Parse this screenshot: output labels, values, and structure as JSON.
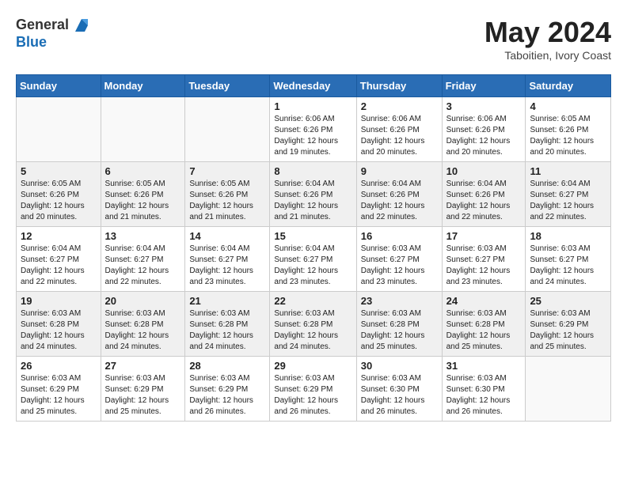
{
  "header": {
    "logo_general": "General",
    "logo_blue": "Blue",
    "month_year": "May 2024",
    "location": "Taboitien, Ivory Coast"
  },
  "weekdays": [
    "Sunday",
    "Monday",
    "Tuesday",
    "Wednesday",
    "Thursday",
    "Friday",
    "Saturday"
  ],
  "weeks": [
    [
      {
        "day": "",
        "info": ""
      },
      {
        "day": "",
        "info": ""
      },
      {
        "day": "",
        "info": ""
      },
      {
        "day": "1",
        "info": "Sunrise: 6:06 AM\nSunset: 6:26 PM\nDaylight: 12 hours\nand 19 minutes."
      },
      {
        "day": "2",
        "info": "Sunrise: 6:06 AM\nSunset: 6:26 PM\nDaylight: 12 hours\nand 20 minutes."
      },
      {
        "day": "3",
        "info": "Sunrise: 6:06 AM\nSunset: 6:26 PM\nDaylight: 12 hours\nand 20 minutes."
      },
      {
        "day": "4",
        "info": "Sunrise: 6:05 AM\nSunset: 6:26 PM\nDaylight: 12 hours\nand 20 minutes."
      }
    ],
    [
      {
        "day": "5",
        "info": "Sunrise: 6:05 AM\nSunset: 6:26 PM\nDaylight: 12 hours\nand 20 minutes."
      },
      {
        "day": "6",
        "info": "Sunrise: 6:05 AM\nSunset: 6:26 PM\nDaylight: 12 hours\nand 21 minutes."
      },
      {
        "day": "7",
        "info": "Sunrise: 6:05 AM\nSunset: 6:26 PM\nDaylight: 12 hours\nand 21 minutes."
      },
      {
        "day": "8",
        "info": "Sunrise: 6:04 AM\nSunset: 6:26 PM\nDaylight: 12 hours\nand 21 minutes."
      },
      {
        "day": "9",
        "info": "Sunrise: 6:04 AM\nSunset: 6:26 PM\nDaylight: 12 hours\nand 22 minutes."
      },
      {
        "day": "10",
        "info": "Sunrise: 6:04 AM\nSunset: 6:26 PM\nDaylight: 12 hours\nand 22 minutes."
      },
      {
        "day": "11",
        "info": "Sunrise: 6:04 AM\nSunset: 6:27 PM\nDaylight: 12 hours\nand 22 minutes."
      }
    ],
    [
      {
        "day": "12",
        "info": "Sunrise: 6:04 AM\nSunset: 6:27 PM\nDaylight: 12 hours\nand 22 minutes."
      },
      {
        "day": "13",
        "info": "Sunrise: 6:04 AM\nSunset: 6:27 PM\nDaylight: 12 hours\nand 22 minutes."
      },
      {
        "day": "14",
        "info": "Sunrise: 6:04 AM\nSunset: 6:27 PM\nDaylight: 12 hours\nand 23 minutes."
      },
      {
        "day": "15",
        "info": "Sunrise: 6:04 AM\nSunset: 6:27 PM\nDaylight: 12 hours\nand 23 minutes."
      },
      {
        "day": "16",
        "info": "Sunrise: 6:03 AM\nSunset: 6:27 PM\nDaylight: 12 hours\nand 23 minutes."
      },
      {
        "day": "17",
        "info": "Sunrise: 6:03 AM\nSunset: 6:27 PM\nDaylight: 12 hours\nand 23 minutes."
      },
      {
        "day": "18",
        "info": "Sunrise: 6:03 AM\nSunset: 6:27 PM\nDaylight: 12 hours\nand 24 minutes."
      }
    ],
    [
      {
        "day": "19",
        "info": "Sunrise: 6:03 AM\nSunset: 6:28 PM\nDaylight: 12 hours\nand 24 minutes."
      },
      {
        "day": "20",
        "info": "Sunrise: 6:03 AM\nSunset: 6:28 PM\nDaylight: 12 hours\nand 24 minutes."
      },
      {
        "day": "21",
        "info": "Sunrise: 6:03 AM\nSunset: 6:28 PM\nDaylight: 12 hours\nand 24 minutes."
      },
      {
        "day": "22",
        "info": "Sunrise: 6:03 AM\nSunset: 6:28 PM\nDaylight: 12 hours\nand 24 minutes."
      },
      {
        "day": "23",
        "info": "Sunrise: 6:03 AM\nSunset: 6:28 PM\nDaylight: 12 hours\nand 25 minutes."
      },
      {
        "day": "24",
        "info": "Sunrise: 6:03 AM\nSunset: 6:28 PM\nDaylight: 12 hours\nand 25 minutes."
      },
      {
        "day": "25",
        "info": "Sunrise: 6:03 AM\nSunset: 6:29 PM\nDaylight: 12 hours\nand 25 minutes."
      }
    ],
    [
      {
        "day": "26",
        "info": "Sunrise: 6:03 AM\nSunset: 6:29 PM\nDaylight: 12 hours\nand 25 minutes."
      },
      {
        "day": "27",
        "info": "Sunrise: 6:03 AM\nSunset: 6:29 PM\nDaylight: 12 hours\nand 25 minutes."
      },
      {
        "day": "28",
        "info": "Sunrise: 6:03 AM\nSunset: 6:29 PM\nDaylight: 12 hours\nand 26 minutes."
      },
      {
        "day": "29",
        "info": "Sunrise: 6:03 AM\nSunset: 6:29 PM\nDaylight: 12 hours\nand 26 minutes."
      },
      {
        "day": "30",
        "info": "Sunrise: 6:03 AM\nSunset: 6:30 PM\nDaylight: 12 hours\nand 26 minutes."
      },
      {
        "day": "31",
        "info": "Sunrise: 6:03 AM\nSunset: 6:30 PM\nDaylight: 12 hours\nand 26 minutes."
      },
      {
        "day": "",
        "info": ""
      }
    ]
  ]
}
